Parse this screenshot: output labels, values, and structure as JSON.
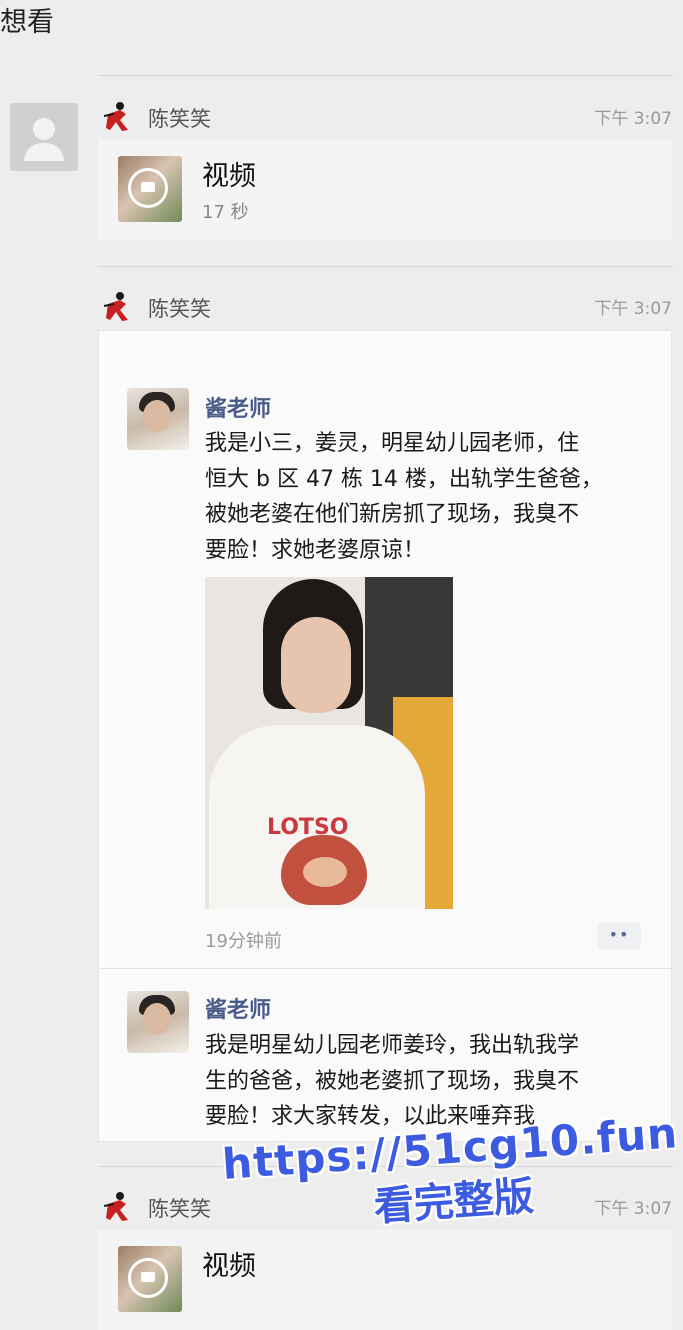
{
  "top_message": {
    "text": "想看"
  },
  "messages": [
    {
      "sender": "陈笑笑",
      "time": "下午 3:07",
      "video": {
        "title": "视频",
        "duration": "17 秒"
      }
    },
    {
      "sender": "陈笑笑",
      "time": "下午 3:07",
      "quoted_moments": [
        {
          "author": "酱老师",
          "text_lines": [
            "我是小三，姜灵，明星幼儿园老师，住",
            "恒大 b 区 47 栋 14 楼，出轨学生爸爸，",
            "被她老婆在他们新房抓了现场，我臭不",
            "要脸！求她老婆原谅！"
          ],
          "photo_shirt_text": "LOTSO",
          "time_ago": "19分钟前",
          "more": "••"
        },
        {
          "author": "酱老师",
          "text_lines": [
            "我是明星幼儿园老师姜玲，我出轨我学",
            "生的爸爸，被她老婆抓了现场，我臭不",
            "要脸！求大家转发，以此来唾弃我"
          ]
        }
      ]
    },
    {
      "sender": "陈笑笑",
      "time": "下午 3:07",
      "video": {
        "title": "视频"
      }
    }
  ],
  "watermark": {
    "url": "https://51cg10.fun",
    "cta": "看完整版"
  },
  "colors": {
    "name_blue": "#4a5d8a",
    "watermark_blue": "#3c5be0",
    "background": "#ededed"
  },
  "icons": {
    "avatar": "default-avatar-icon",
    "sender": "dancer-emoji-icon",
    "video": "video-play-icon"
  }
}
